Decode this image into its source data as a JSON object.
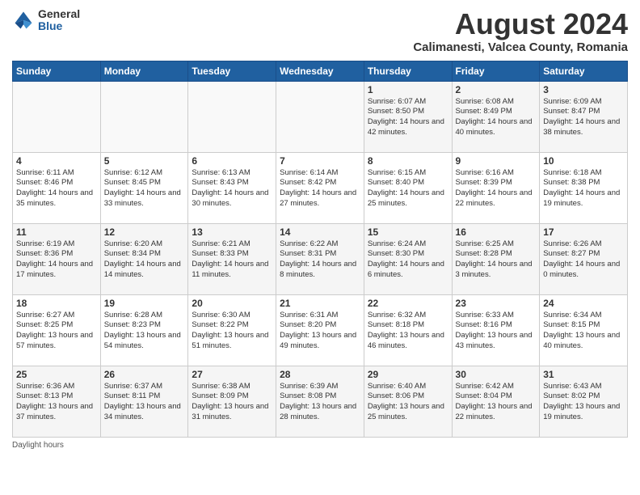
{
  "logo": {
    "general": "General",
    "blue": "Blue"
  },
  "title": "August 2024",
  "subtitle": "Calimanesti, Valcea County, Romania",
  "days_of_week": [
    "Sunday",
    "Monday",
    "Tuesday",
    "Wednesday",
    "Thursday",
    "Friday",
    "Saturday"
  ],
  "footer": "Daylight hours",
  "weeks": [
    [
      {
        "day": "",
        "info": ""
      },
      {
        "day": "",
        "info": ""
      },
      {
        "day": "",
        "info": ""
      },
      {
        "day": "",
        "info": ""
      },
      {
        "day": "1",
        "info": "Sunrise: 6:07 AM\nSunset: 8:50 PM\nDaylight: 14 hours\nand 42 minutes."
      },
      {
        "day": "2",
        "info": "Sunrise: 6:08 AM\nSunset: 8:49 PM\nDaylight: 14 hours\nand 40 minutes."
      },
      {
        "day": "3",
        "info": "Sunrise: 6:09 AM\nSunset: 8:47 PM\nDaylight: 14 hours\nand 38 minutes."
      }
    ],
    [
      {
        "day": "4",
        "info": "Sunrise: 6:11 AM\nSunset: 8:46 PM\nDaylight: 14 hours\nand 35 minutes."
      },
      {
        "day": "5",
        "info": "Sunrise: 6:12 AM\nSunset: 8:45 PM\nDaylight: 14 hours\nand 33 minutes."
      },
      {
        "day": "6",
        "info": "Sunrise: 6:13 AM\nSunset: 8:43 PM\nDaylight: 14 hours\nand 30 minutes."
      },
      {
        "day": "7",
        "info": "Sunrise: 6:14 AM\nSunset: 8:42 PM\nDaylight: 14 hours\nand 27 minutes."
      },
      {
        "day": "8",
        "info": "Sunrise: 6:15 AM\nSunset: 8:40 PM\nDaylight: 14 hours\nand 25 minutes."
      },
      {
        "day": "9",
        "info": "Sunrise: 6:16 AM\nSunset: 8:39 PM\nDaylight: 14 hours\nand 22 minutes."
      },
      {
        "day": "10",
        "info": "Sunrise: 6:18 AM\nSunset: 8:38 PM\nDaylight: 14 hours\nand 19 minutes."
      }
    ],
    [
      {
        "day": "11",
        "info": "Sunrise: 6:19 AM\nSunset: 8:36 PM\nDaylight: 14 hours\nand 17 minutes."
      },
      {
        "day": "12",
        "info": "Sunrise: 6:20 AM\nSunset: 8:34 PM\nDaylight: 14 hours\nand 14 minutes."
      },
      {
        "day": "13",
        "info": "Sunrise: 6:21 AM\nSunset: 8:33 PM\nDaylight: 14 hours\nand 11 minutes."
      },
      {
        "day": "14",
        "info": "Sunrise: 6:22 AM\nSunset: 8:31 PM\nDaylight: 14 hours\nand 8 minutes."
      },
      {
        "day": "15",
        "info": "Sunrise: 6:24 AM\nSunset: 8:30 PM\nDaylight: 14 hours\nand 6 minutes."
      },
      {
        "day": "16",
        "info": "Sunrise: 6:25 AM\nSunset: 8:28 PM\nDaylight: 14 hours\nand 3 minutes."
      },
      {
        "day": "17",
        "info": "Sunrise: 6:26 AM\nSunset: 8:27 PM\nDaylight: 14 hours\nand 0 minutes."
      }
    ],
    [
      {
        "day": "18",
        "info": "Sunrise: 6:27 AM\nSunset: 8:25 PM\nDaylight: 13 hours\nand 57 minutes."
      },
      {
        "day": "19",
        "info": "Sunrise: 6:28 AM\nSunset: 8:23 PM\nDaylight: 13 hours\nand 54 minutes."
      },
      {
        "day": "20",
        "info": "Sunrise: 6:30 AM\nSunset: 8:22 PM\nDaylight: 13 hours\nand 51 minutes."
      },
      {
        "day": "21",
        "info": "Sunrise: 6:31 AM\nSunset: 8:20 PM\nDaylight: 13 hours\nand 49 minutes."
      },
      {
        "day": "22",
        "info": "Sunrise: 6:32 AM\nSunset: 8:18 PM\nDaylight: 13 hours\nand 46 minutes."
      },
      {
        "day": "23",
        "info": "Sunrise: 6:33 AM\nSunset: 8:16 PM\nDaylight: 13 hours\nand 43 minutes."
      },
      {
        "day": "24",
        "info": "Sunrise: 6:34 AM\nSunset: 8:15 PM\nDaylight: 13 hours\nand 40 minutes."
      }
    ],
    [
      {
        "day": "25",
        "info": "Sunrise: 6:36 AM\nSunset: 8:13 PM\nDaylight: 13 hours\nand 37 minutes."
      },
      {
        "day": "26",
        "info": "Sunrise: 6:37 AM\nSunset: 8:11 PM\nDaylight: 13 hours\nand 34 minutes."
      },
      {
        "day": "27",
        "info": "Sunrise: 6:38 AM\nSunset: 8:09 PM\nDaylight: 13 hours\nand 31 minutes."
      },
      {
        "day": "28",
        "info": "Sunrise: 6:39 AM\nSunset: 8:08 PM\nDaylight: 13 hours\nand 28 minutes."
      },
      {
        "day": "29",
        "info": "Sunrise: 6:40 AM\nSunset: 8:06 PM\nDaylight: 13 hours\nand 25 minutes."
      },
      {
        "day": "30",
        "info": "Sunrise: 6:42 AM\nSunset: 8:04 PM\nDaylight: 13 hours\nand 22 minutes."
      },
      {
        "day": "31",
        "info": "Sunrise: 6:43 AM\nSunset: 8:02 PM\nDaylight: 13 hours\nand 19 minutes."
      }
    ]
  ]
}
